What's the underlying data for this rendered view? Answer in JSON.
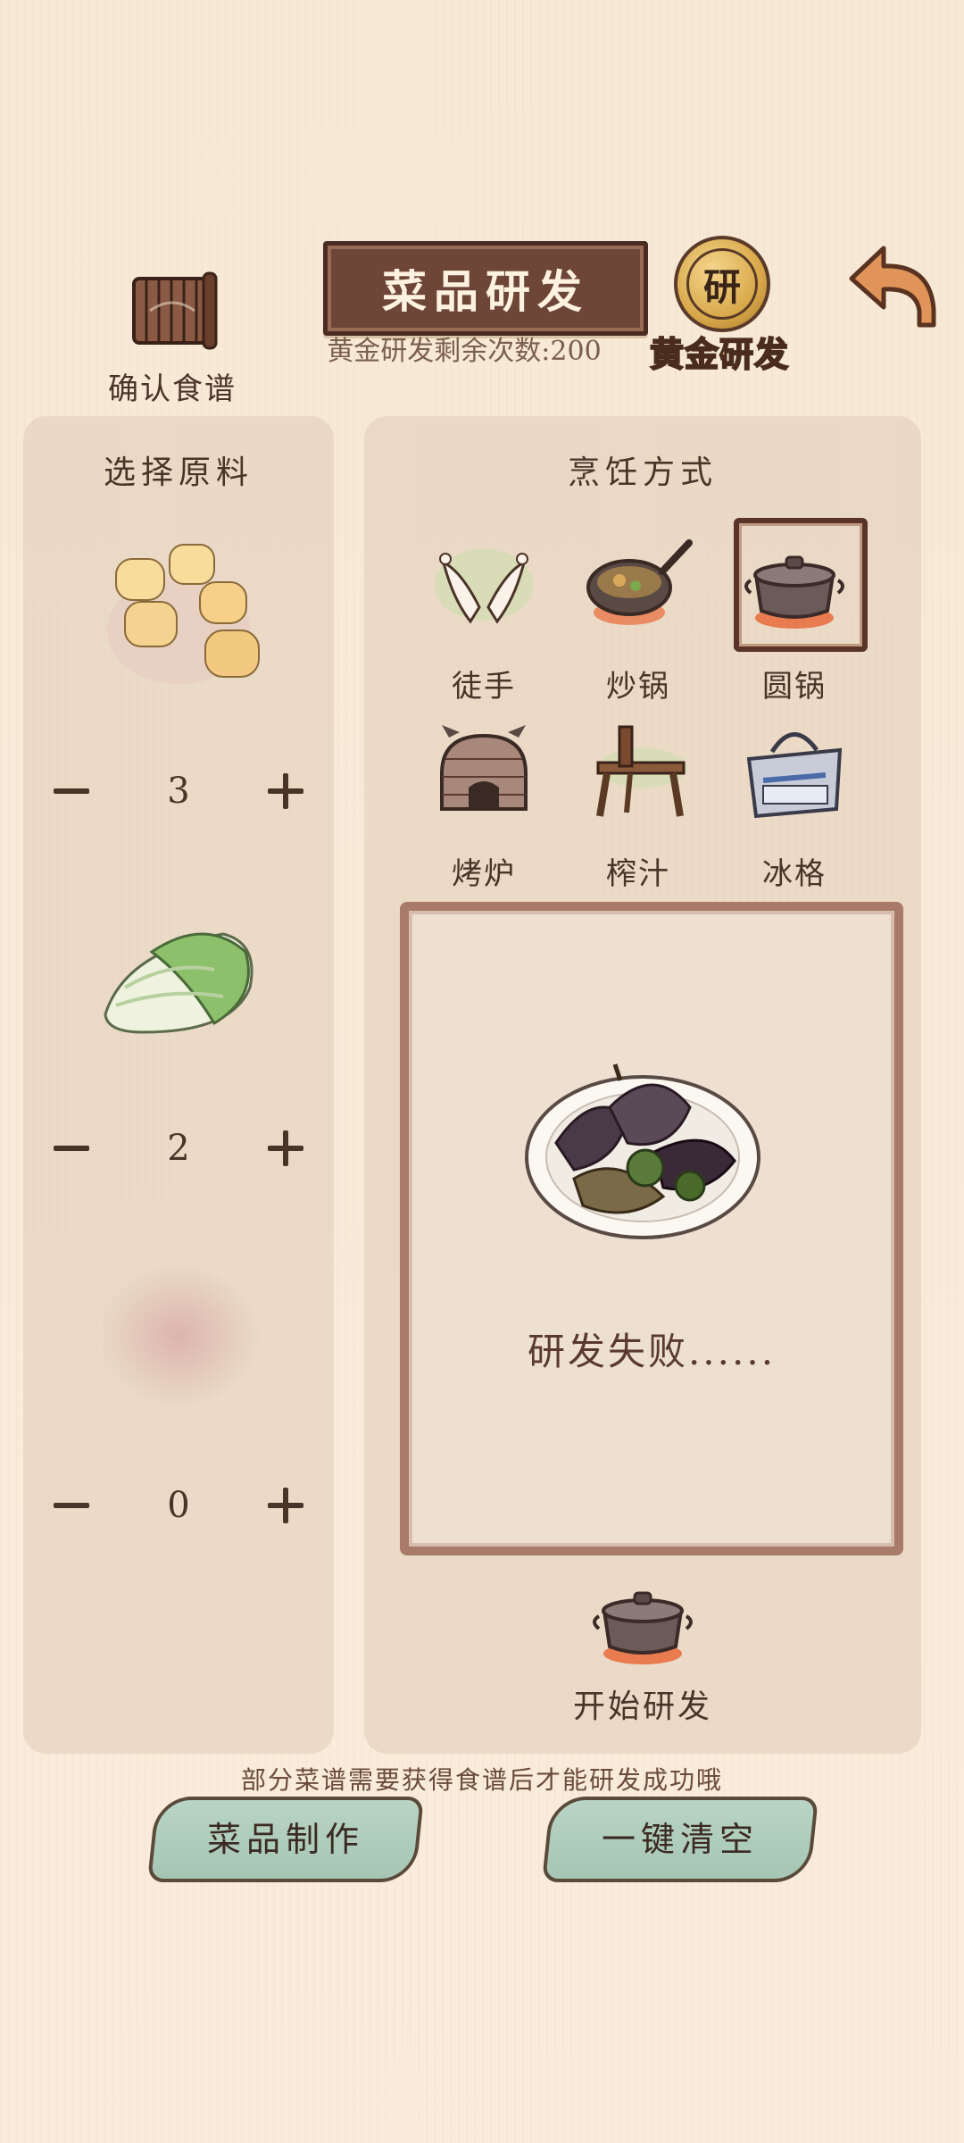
{
  "header": {
    "confirm_recipe_label": "确认食谱",
    "title": "菜品研发",
    "gold_remaining_text": "黄金研发剩余次数:200",
    "gold_research_label": "黄金研发",
    "gold_coin_glyph": "研"
  },
  "ingredients": {
    "title": "选择原料",
    "items": [
      {
        "icon": "scallop-icon",
        "qty": "3"
      },
      {
        "icon": "cabbage-icon",
        "qty": "2"
      },
      {
        "icon": "empty-slot-icon",
        "qty": "0"
      }
    ]
  },
  "cooking": {
    "title": "烹饪方式",
    "methods": [
      {
        "label": "徒手",
        "icon": "hands-icon",
        "selected": false
      },
      {
        "label": "炒锅",
        "icon": "wok-icon",
        "selected": false
      },
      {
        "label": "圆锅",
        "icon": "round-pot-icon",
        "selected": true
      },
      {
        "label": "烤炉",
        "icon": "oven-icon",
        "selected": false
      },
      {
        "label": "榨汁",
        "icon": "juicer-icon",
        "selected": false
      },
      {
        "label": "冰格",
        "icon": "ice-box-icon",
        "selected": false
      }
    ]
  },
  "result": {
    "text": "研发失败......",
    "icon": "failed-dish-icon"
  },
  "start_button_label": "开始研发",
  "hint": "部分菜谱需要获得食谱后才能研发成功哦",
  "buttons": {
    "make_dish": "菜品制作",
    "clear_all": "一键清空"
  }
}
